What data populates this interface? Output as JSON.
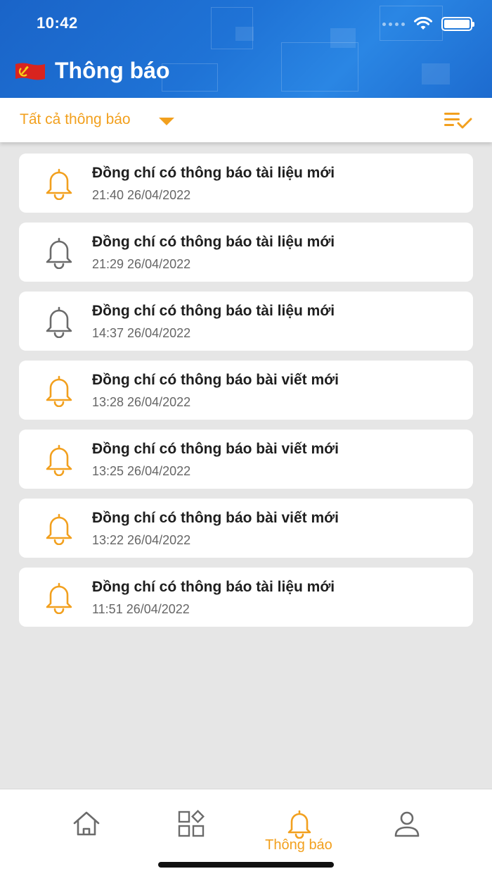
{
  "status_bar": {
    "time": "10:42"
  },
  "header": {
    "title": "Thông báo"
  },
  "filter": {
    "label": "Tất cả thông báo"
  },
  "notifications": [
    {
      "title": "Đồng chí có thông báo tài liệu mới",
      "time": "21:40 26/04/2022",
      "unread": true
    },
    {
      "title": "Đồng chí có thông báo tài liệu mới",
      "time": "21:29 26/04/2022",
      "unread": false
    },
    {
      "title": "Đồng chí có thông báo tài liệu mới",
      "time": "14:37 26/04/2022",
      "unread": false
    },
    {
      "title": "Đồng chí có thông báo bài viết mới",
      "time": "13:28 26/04/2022",
      "unread": true
    },
    {
      "title": "Đồng chí có thông báo bài viết mới",
      "time": "13:25 26/04/2022",
      "unread": true
    },
    {
      "title": "Đồng chí có thông báo bài viết mới",
      "time": "13:22 26/04/2022",
      "unread": true
    },
    {
      "title": "Đồng chí có thông báo tài liệu mới",
      "time": "11:51 26/04/2022",
      "unread": true
    }
  ],
  "tabbar": {
    "tabs": [
      {
        "icon": "home-icon",
        "label": ""
      },
      {
        "icon": "apps-grid-icon",
        "label": ""
      },
      {
        "icon": "bell-icon",
        "label": "Thông báo",
        "active": true
      },
      {
        "icon": "user-icon",
        "label": ""
      }
    ]
  },
  "colors": {
    "accent": "#f2a01e",
    "header": "#1f73d6",
    "read_icon": "#6b6b6b"
  }
}
